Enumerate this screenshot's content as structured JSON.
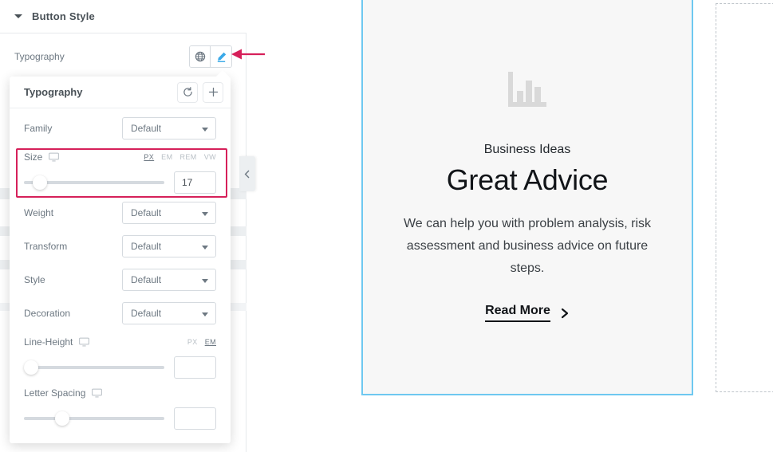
{
  "panel": {
    "section_title": "Button Style",
    "caret_icon": "caret-down-icon",
    "typography_label": "Typography",
    "globe_icon": "globe-icon",
    "edit_icon": "pencil-edit-icon",
    "collapse_icon": "chevron-left-icon"
  },
  "popover": {
    "title": "Typography",
    "reset_icon": "reset-icon",
    "add_icon": "plus-icon",
    "fields": [
      {
        "label": "Family",
        "value": "Default",
        "name": "family"
      },
      {
        "label": "Weight",
        "value": "Default",
        "name": "weight"
      },
      {
        "label": "Transform",
        "value": "Default",
        "name": "transform"
      },
      {
        "label": "Style",
        "value": "Default",
        "name": "style"
      },
      {
        "label": "Decoration",
        "value": "Default",
        "name": "decoration"
      }
    ],
    "size": {
      "label": "Size",
      "device_icon": "desktop-monitor-icon",
      "units": [
        "PX",
        "EM",
        "REM",
        "VW"
      ],
      "active_unit": "PX",
      "value": "17",
      "thumb_percent": 6
    },
    "line_height": {
      "label": "Line-Height",
      "device_icon": "desktop-monitor-icon",
      "units": [
        "PX",
        "EM"
      ],
      "active_unit": "EM",
      "value": "",
      "thumb_percent": 0
    },
    "letter_spacing": {
      "label": "Letter Spacing",
      "device_icon": "desktop-monitor-icon",
      "units": [],
      "active_unit": "",
      "value": "",
      "thumb_percent": 22
    }
  },
  "preview": {
    "chart_icon": "bar-chart-icon",
    "eyebrow": "Business Ideas",
    "headline": "Great Advice",
    "body": "We can help you with problem analysis, risk assessment and business advice on future steps.",
    "cta_label": "Read More",
    "cta_icon": "chevron-right-icon"
  },
  "annotation": {
    "arrow_icon": "left-pointing-arrow",
    "highlight_target": "size-control",
    "color": "#d6205a"
  },
  "colors": {
    "accent_pink": "#d6205a",
    "widget_border_blue": "#6ec8f0",
    "active_icon_blue": "#3aa9e8",
    "panel_border": "#e6e9ec",
    "text_muted": "#6d7882"
  }
}
